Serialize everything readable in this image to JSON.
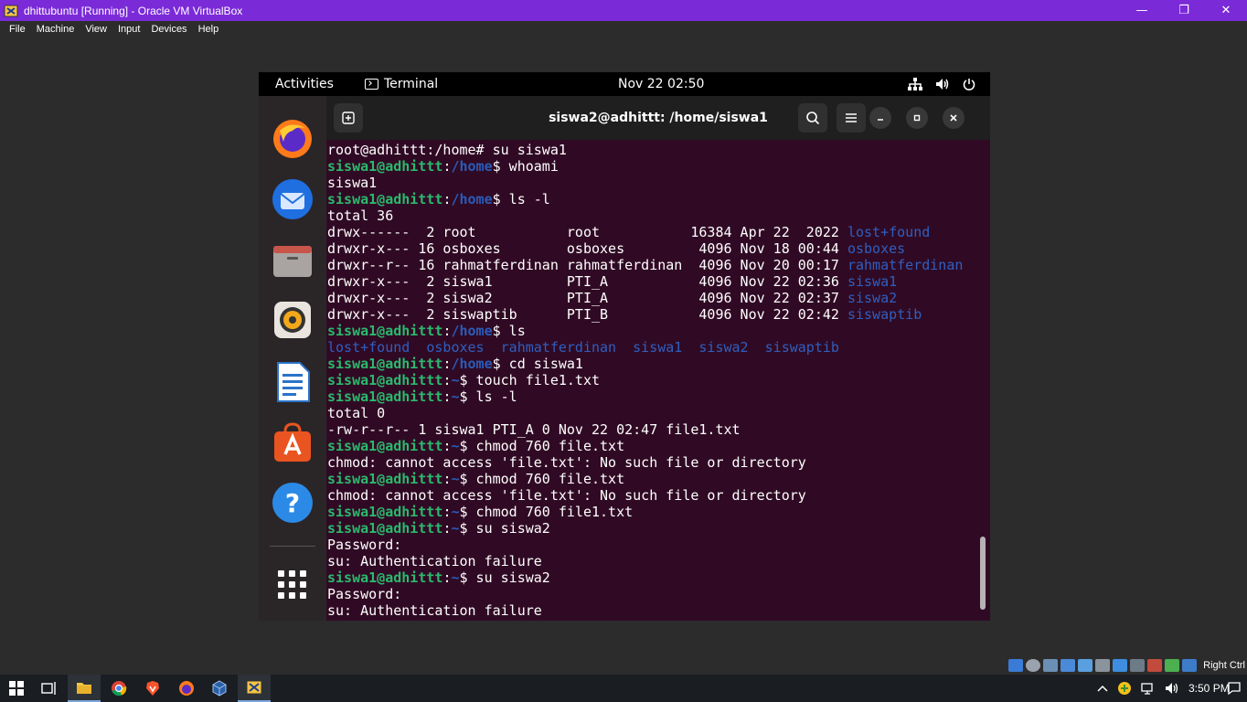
{
  "vb_window": {
    "title": "dhittubuntu [Running] - Oracle VM VirtualBox",
    "menu": [
      "File",
      "Machine",
      "View",
      "Input",
      "Devices",
      "Help"
    ],
    "controls": {
      "minimize": "—",
      "restore": "❐",
      "close": "✕"
    },
    "host_key_label": "Right Ctrl",
    "accent_color": "#7b2ad8"
  },
  "gnome": {
    "activities": "Activities",
    "app_name": "Terminal",
    "clock": "Nov 22  02:50"
  },
  "dock": {
    "apps": [
      "firefox-icon",
      "thunderbird-icon",
      "files-icon",
      "rhythmbox-icon",
      "libreoffice-writer-icon",
      "ubuntu-software-icon",
      "help-icon",
      "show-apps-icon"
    ],
    "help_glyph": "?"
  },
  "terminal": {
    "title": "siswa2@adhittt: /home/siswa1",
    "lines": [
      [
        {
          "t": "root@adhittt:/home# su siswa1",
          "c": "plain"
        }
      ],
      [
        {
          "t": "siswa1@adhittt",
          "c": "pu"
        },
        {
          "t": ":",
          "c": "plain"
        },
        {
          "t": "/home",
          "c": "pp"
        },
        {
          "t": "$ whoami",
          "c": "plain"
        }
      ],
      [
        {
          "t": "siswa1",
          "c": "plain"
        }
      ],
      [
        {
          "t": "siswa1@adhittt",
          "c": "pu"
        },
        {
          "t": ":",
          "c": "plain"
        },
        {
          "t": "/home",
          "c": "pp"
        },
        {
          "t": "$ ls -l",
          "c": "plain"
        }
      ],
      [
        {
          "t": "total 36",
          "c": "plain"
        }
      ],
      [
        {
          "t": "drwx------  2 root           root           16384 Apr 22  2022 ",
          "c": "plain"
        },
        {
          "t": "lost+found",
          "c": "dir"
        }
      ],
      [
        {
          "t": "drwxr-x--- 16 osboxes        osboxes         4096 Nov 18 00:44 ",
          "c": "plain"
        },
        {
          "t": "osboxes",
          "c": "dir"
        }
      ],
      [
        {
          "t": "drwxr--r-- 16 rahmatferdinan rahmatferdinan  4096 Nov 20 00:17 ",
          "c": "plain"
        },
        {
          "t": "rahmatferdinan",
          "c": "dir"
        }
      ],
      [
        {
          "t": "drwxr-x---  2 siswa1         PTI_A           4096 Nov 22 02:36 ",
          "c": "plain"
        },
        {
          "t": "siswa1",
          "c": "dir"
        }
      ],
      [
        {
          "t": "drwxr-x---  2 siswa2         PTI_A           4096 Nov 22 02:37 ",
          "c": "plain"
        },
        {
          "t": "siswa2",
          "c": "dir"
        }
      ],
      [
        {
          "t": "drwxr-x---  2 siswaptib      PTI_B           4096 Nov 22 02:42 ",
          "c": "plain"
        },
        {
          "t": "siswaptib",
          "c": "dir"
        }
      ],
      [
        {
          "t": "siswa1@adhittt",
          "c": "pu"
        },
        {
          "t": ":",
          "c": "plain"
        },
        {
          "t": "/home",
          "c": "pp"
        },
        {
          "t": "$ ls",
          "c": "plain"
        }
      ],
      [
        {
          "t": "lost+found  osboxes  rahmatferdinan  siswa1  siswa2  siswaptib",
          "c": "dir"
        }
      ],
      [
        {
          "t": "siswa1@adhittt",
          "c": "pu"
        },
        {
          "t": ":",
          "c": "plain"
        },
        {
          "t": "/home",
          "c": "pp"
        },
        {
          "t": "$ cd siswa1",
          "c": "plain"
        }
      ],
      [
        {
          "t": "siswa1@adhittt",
          "c": "pu"
        },
        {
          "t": ":",
          "c": "plain"
        },
        {
          "t": "~",
          "c": "pp"
        },
        {
          "t": "$ touch file1.txt",
          "c": "plain"
        }
      ],
      [
        {
          "t": "siswa1@adhittt",
          "c": "pu"
        },
        {
          "t": ":",
          "c": "plain"
        },
        {
          "t": "~",
          "c": "pp"
        },
        {
          "t": "$ ls -l",
          "c": "plain"
        }
      ],
      [
        {
          "t": "total 0",
          "c": "plain"
        }
      ],
      [
        {
          "t": "-rw-r--r-- 1 siswa1 PTI_A 0 Nov 22 02:47 file1.txt",
          "c": "plain"
        }
      ],
      [
        {
          "t": "siswa1@adhittt",
          "c": "pu"
        },
        {
          "t": ":",
          "c": "plain"
        },
        {
          "t": "~",
          "c": "pp"
        },
        {
          "t": "$ chmod 760 file.txt",
          "c": "plain"
        }
      ],
      [
        {
          "t": "chmod: cannot access 'file.txt': No such file or directory",
          "c": "plain"
        }
      ],
      [
        {
          "t": "siswa1@adhittt",
          "c": "pu"
        },
        {
          "t": ":",
          "c": "plain"
        },
        {
          "t": "~",
          "c": "pp"
        },
        {
          "t": "$ chmod 760 file.txt",
          "c": "plain"
        }
      ],
      [
        {
          "t": "chmod: cannot access 'file.txt': No such file or directory",
          "c": "plain"
        }
      ],
      [
        {
          "t": "siswa1@adhittt",
          "c": "pu"
        },
        {
          "t": ":",
          "c": "plain"
        },
        {
          "t": "~",
          "c": "pp"
        },
        {
          "t": "$ chmod 760 file1.txt",
          "c": "plain"
        }
      ],
      [
        {
          "t": "siswa1@adhittt",
          "c": "pu"
        },
        {
          "t": ":",
          "c": "plain"
        },
        {
          "t": "~",
          "c": "pp"
        },
        {
          "t": "$ su siswa2",
          "c": "plain"
        }
      ],
      [
        {
          "t": "Password:",
          "c": "plain"
        }
      ],
      [
        {
          "t": "su: Authentication failure",
          "c": "plain"
        }
      ],
      [
        {
          "t": "siswa1@adhittt",
          "c": "pu"
        },
        {
          "t": ":",
          "c": "plain"
        },
        {
          "t": "~",
          "c": "pp"
        },
        {
          "t": "$ su siswa2",
          "c": "plain"
        }
      ],
      [
        {
          "t": "Password:",
          "c": "plain"
        }
      ],
      [
        {
          "t": "su: Authentication failure",
          "c": "plain"
        }
      ]
    ],
    "colors": {
      "background": "#300a24",
      "prompt_user": "#2bb96d",
      "prompt_path": "#2a5bb8",
      "directory": "#2f5fc0"
    }
  },
  "taskbar": {
    "clock": "3:50 PM",
    "apps": [
      "windows-start-icon",
      "task-view-icon",
      "file-explorer-icon",
      "chrome-icon",
      "brave-icon",
      "firefox-icon",
      "virtualbox-manager-icon",
      "virtualbox-vm-icon"
    ]
  }
}
